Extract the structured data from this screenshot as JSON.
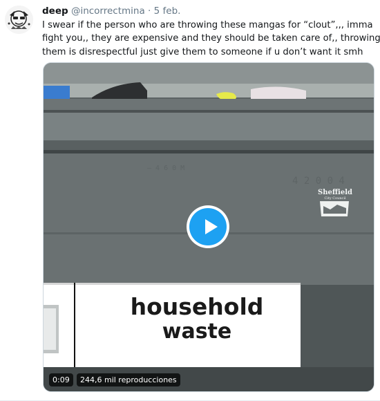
{
  "tweet": {
    "author_name": "deep",
    "handle": "@incorrectmina",
    "separator": "·",
    "date": "5 feb.",
    "text_lines": [
      "I swear if the person who are throwing these mangas for “clout”,,,  imma",
      "fight you,, they are expensive and they should be taken care of,, throwing",
      "them is disrespectful just give them to someone if u don’t want it smh"
    ]
  },
  "video": {
    "duration": "0:09",
    "views": "244,6 mil reproducciones",
    "bin_label_line1": "household",
    "bin_label_line2": "waste",
    "council_line1": "Sheffield",
    "council_line2": "City Council",
    "play_icon": "play-icon",
    "accent_color": "#1da1f2"
  }
}
